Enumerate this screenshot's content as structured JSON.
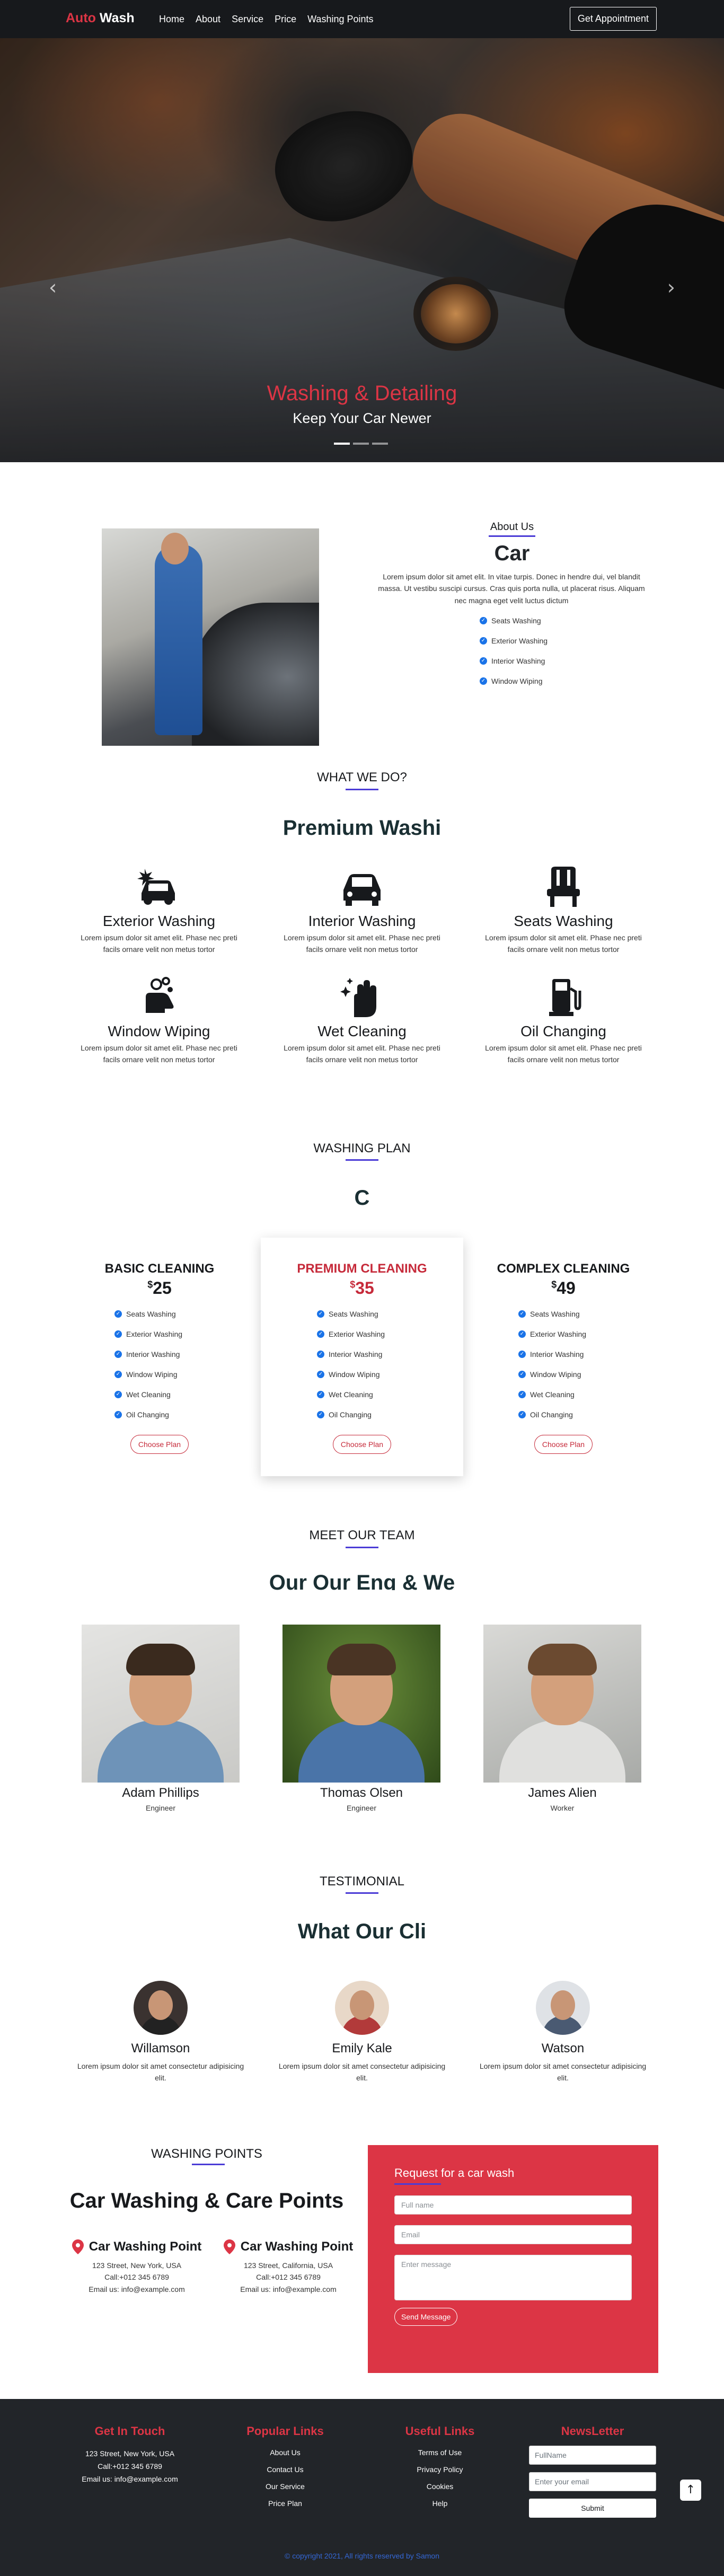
{
  "nav": {
    "brand_part1": "Auto",
    "brand_part2": "Wash",
    "items": [
      "Home",
      "About",
      "Service",
      "Price",
      "Washing Points"
    ],
    "cta": "Get Appointment"
  },
  "hero": {
    "title": "Washing & Detailing",
    "subtitle": "Keep Your Car Newer",
    "prev_icon": "chevron-left-icon",
    "next_icon": "chevron-right-icon",
    "slides": 3,
    "active_slide": 1
  },
  "about": {
    "label": "About Us",
    "title": "Car",
    "text": "Lorem ipsum dolor sit amet elit. In vitae turpis. Donec in hendre dui, vel blandit massa. Ut vestibu suscipi cursus. Cras quis porta nulla, ut placerat risus. Aliquam nec magna eget velit luctus dictum",
    "features": [
      "Seats Washing",
      "Exterior Washing",
      "Interior Washing",
      "Window Wiping"
    ]
  },
  "services": {
    "label": "WHAT WE DO?",
    "title": "Premium Washi",
    "items": [
      {
        "title": "Exterior Washing",
        "text": "Lorem ipsum dolor sit amet elit. Phase nec preti facils ornare velit non metus tortor",
        "icon": "car-wash-icon"
      },
      {
        "title": "Interior Washing",
        "text": "Lorem ipsum dolor sit amet elit. Phase nec preti facils ornare velit non metus tortor",
        "icon": "car-icon"
      },
      {
        "title": "Seats Washing",
        "text": "Lorem ipsum dolor sit amet elit. Phase nec preti facils ornare velit non metus tortor",
        "icon": "seat-icon"
      },
      {
        "title": "Window Wiping",
        "text": "Lorem ipsum dolor sit amet elit. Phase nec preti facils ornare velit non metus tortor",
        "icon": "hand-wash-icon"
      },
      {
        "title": "Wet Cleaning",
        "text": "Lorem ipsum dolor sit amet elit. Phase nec preti facils ornare velit non metus tortor",
        "icon": "sparkle-hand-icon"
      },
      {
        "title": "Oil Changing",
        "text": "Lorem ipsum dolor sit amet elit. Phase nec preti facils ornare velit non metus tortor",
        "icon": "fuel-pump-icon"
      }
    ]
  },
  "plans": {
    "label": "WASHING PLAN",
    "title": "C",
    "items": [
      {
        "name": "BASIC CLEANING",
        "currency": "$",
        "price": "25",
        "features": [
          "Seats Washing",
          "Exterior Washing",
          "Interior Washing",
          "Window Wiping",
          "Wet Cleaning",
          "Oil Changing"
        ],
        "button": "Choose Plan"
      },
      {
        "name": "PREMIUM CLEANING",
        "currency": "$",
        "price": "35",
        "features": [
          "Seats Washing",
          "Exterior Washing",
          "Interior Washing",
          "Window Wiping",
          "Wet Cleaning",
          "Oil Changing"
        ],
        "button": "Choose Plan"
      },
      {
        "name": "COMPLEX CLEANING",
        "currency": "$",
        "price": "49",
        "features": [
          "Seats Washing",
          "Exterior Washing",
          "Interior Washing",
          "Window Wiping",
          "Wet Cleaning",
          "Oil Changing"
        ],
        "button": "Choose Plan"
      }
    ]
  },
  "team": {
    "label": "MEET OUR TEAM",
    "title": "Our Our Eng & We",
    "members": [
      {
        "name": "Adam Phillips",
        "role": "Engineer"
      },
      {
        "name": "Thomas Olsen",
        "role": "Engineer"
      },
      {
        "name": "James Alien",
        "role": "Worker"
      }
    ]
  },
  "testimonial": {
    "label": "TESTIMONIAL",
    "title": "What Our Cli",
    "items": [
      {
        "name": "Willamson",
        "text": "Lorem ipsum dolor sit amet consectetur adipisicing elit."
      },
      {
        "name": "Emily Kale",
        "text": "Lorem ipsum dolor sit amet consectetur adipisicing elit."
      },
      {
        "name": "Watson",
        "text": "Lorem ipsum dolor sit amet consectetur adipisicing elit."
      }
    ]
  },
  "washing_points": {
    "label": "WASHING POINTS",
    "title": "Car Washing & Care Points",
    "points": [
      {
        "name": "Car Washing Point",
        "address": "123 Street, New York, USA",
        "call": "Call:+012 345 6789",
        "email": "Email us: info@example.com"
      },
      {
        "name": "Car Washing Point",
        "address": "123 Street, California, USA",
        "call": "Call:+012 345 6789",
        "email": "Email us: info@example.com"
      }
    ]
  },
  "request": {
    "title": "Request for a car wash",
    "fullname_placeholder": "Full name",
    "email_placeholder": "Email",
    "message_placeholder": "Enter message",
    "button": "Send Message"
  },
  "footer": {
    "touch_title": "Get In Touch",
    "touch_address": "123 Street, New York, USA",
    "touch_call": "Call:+012 345 6789",
    "touch_email": "Email us: info@example.com",
    "popular_title": "Popular Links",
    "popular_links": [
      "About Us",
      "Contact Us",
      "Our Service",
      "Price Plan"
    ],
    "useful_title": "Useful Links",
    "useful_links": [
      "Terms of Use",
      "Privacy Policy",
      "Cookies",
      "Help"
    ],
    "newsletter_title": "NewsLetter",
    "newsletter_name_placeholder": "FullName",
    "newsletter_email_placeholder": "Enter your email",
    "newsletter_button": "Submit",
    "copyright": "© copyright 2021, All rights reserved by Samon",
    "back_to_top_icon": "arrow-up-icon"
  },
  "colors": {
    "accent_red": "#dc3545",
    "underline_blue": "#4b3cd6",
    "check_blue": "#1a73e8",
    "dark": "#17191c"
  }
}
